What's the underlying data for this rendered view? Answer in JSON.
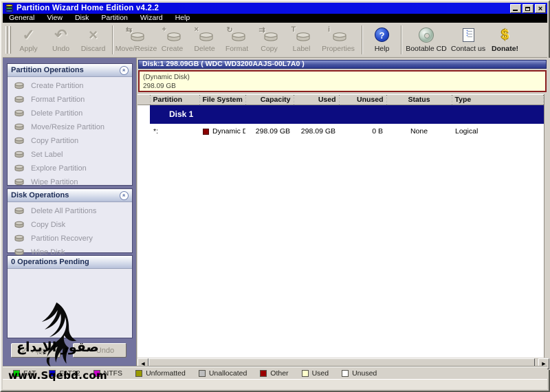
{
  "window": {
    "title": "Partition Wizard Home Edition v4.2.2"
  },
  "menubar": {
    "items": [
      "General",
      "View",
      "Disk",
      "Partition",
      "Wizard",
      "Help"
    ]
  },
  "toolbar": {
    "buttons": [
      {
        "label": "Apply",
        "glyph": "✓"
      },
      {
        "label": "Undo",
        "glyph": "↶"
      },
      {
        "label": "Discard",
        "glyph": "×"
      },
      {
        "label": "Move/Resize",
        "glyph": "⇆"
      },
      {
        "label": "Create",
        "glyph": "+"
      },
      {
        "label": "Delete",
        "glyph": "×"
      },
      {
        "label": "Format",
        "glyph": "↻"
      },
      {
        "label": "Copy",
        "glyph": "⇉"
      },
      {
        "label": "Label",
        "glyph": "T"
      },
      {
        "label": "Properties",
        "glyph": "i"
      },
      {
        "label": "Help",
        "glyph": "?"
      },
      {
        "label": "Bootable CD"
      },
      {
        "label": "Contact us"
      },
      {
        "label": "Donate!",
        "glyph": "$"
      }
    ]
  },
  "sidebar": {
    "partition_ops": {
      "title": "Partition Operations",
      "items": [
        "Create Partition",
        "Format Partition",
        "Delete Partition",
        "Move/Resize Partition",
        "Copy Partition",
        "Set Label",
        "Explore Partition",
        "Wipe Partition"
      ]
    },
    "disk_ops": {
      "title": "Disk Operations",
      "items": [
        "Delete All Partitions",
        "Copy Disk",
        "Partition Recovery",
        "Wipe Disk"
      ]
    },
    "pending": {
      "title": "0 Operations Pending"
    },
    "apply_label": "Apply",
    "undo_label": "Undo"
  },
  "main": {
    "disk_header": "Disk:1 298.09GB  ( WDC WD3200AAJS-00L7A0 )",
    "disk_map": {
      "line1": "(Dynamic Disk)",
      "line2": "298.09 GB"
    },
    "table": {
      "columns": [
        "Partition",
        "File System",
        "Capacity",
        "Used",
        "Unused",
        "Status",
        "Type"
      ],
      "group_row": "Disk 1",
      "row": {
        "partition": "*:",
        "file_system": "Dynamic Di...",
        "fs_color": "#8b0000",
        "capacity": "298.09 GB",
        "used": "298.09 GB",
        "unused": "0 B",
        "status": "None",
        "type": "Logical"
      }
    }
  },
  "legend": {
    "items": [
      {
        "label": "FAT",
        "color": "#00d400"
      },
      {
        "label": "FAT32",
        "color": "#0000cc"
      },
      {
        "label": "NTFS",
        "color": "#cc00cc"
      },
      {
        "label": "Unformatted",
        "color": "#9a9a00"
      },
      {
        "label": "Unallocated",
        "color": "#bdbdbd"
      },
      {
        "label": "Other",
        "color": "#990000"
      },
      {
        "label": "Used",
        "color": "#ffffcc"
      },
      {
        "label": "Unused",
        "color": "#ffffff"
      }
    ]
  },
  "watermark": {
    "arabic": "صقور الإبداع",
    "site": "www.Sqebd.com"
  }
}
